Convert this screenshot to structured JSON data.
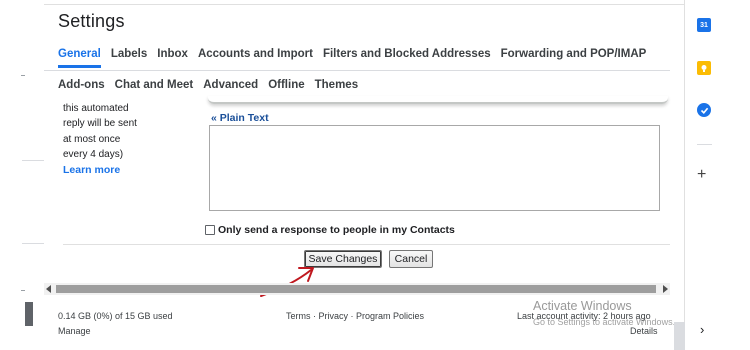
{
  "title": "Settings",
  "tabs_row1": [
    "General",
    "Labels",
    "Inbox",
    "Accounts and Import",
    "Filters and Blocked Addresses",
    "Forwarding and POP/IMAP"
  ],
  "tabs_row2": [
    "Add-ons",
    "Chat and Meet",
    "Advanced",
    "Offline",
    "Themes"
  ],
  "active_tab": "General",
  "side_note": {
    "lines": [
      "this automated",
      "reply will be sent",
      "at most once",
      "every 4 days)"
    ],
    "learn_more": "Learn more"
  },
  "editor": {
    "plain_text_link": "« Plain Text",
    "body": ""
  },
  "contacts_checkbox": {
    "label": "Only send a response to people in my Contacts",
    "checked": false
  },
  "buttons": {
    "save": "Save Changes",
    "cancel": "Cancel"
  },
  "footer": {
    "storage": "0.14 GB (0%) of 15 GB used",
    "manage": "Manage",
    "links": "Terms · Privacy · Program Policies",
    "activity": "Last account activity: 2 hours ago",
    "details": "Details"
  },
  "watermark": {
    "line1": "Activate Windows",
    "line2": "Go to Settings to activate Windows."
  },
  "side_panel": {
    "calendar_badge": "31",
    "plus": "+",
    "chevron": "›"
  },
  "colors": {
    "accent": "#1a73e8",
    "annotation_arrow": "#c0181f"
  }
}
